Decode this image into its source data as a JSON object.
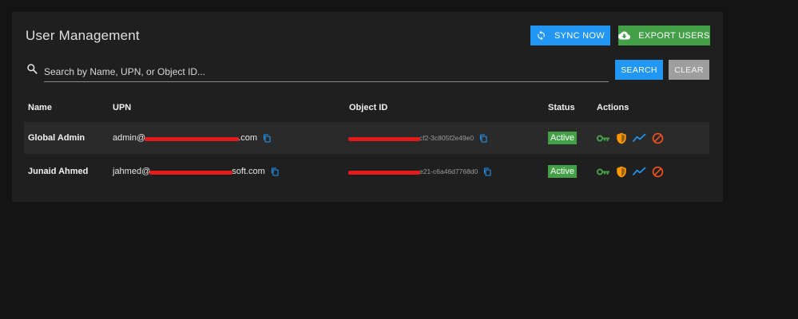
{
  "header": {
    "title": "User Management",
    "sync_label": "SYNC NOW",
    "export_label": "EXPORT USERS"
  },
  "search": {
    "placeholder": "Search by Name, UPN, or Object ID...",
    "value": "",
    "search_label": "SEARCH",
    "clear_label": "CLEAR"
  },
  "table": {
    "columns": [
      "Name",
      "UPN",
      "Object ID",
      "Status",
      "Actions"
    ],
    "rows": [
      {
        "name": "Global Admin",
        "upn_prefix": "admin@",
        "upn_suffix": ".com",
        "oid_suffix": "cf2-3c805f2e49e0",
        "status": "Active"
      },
      {
        "name": "Junaid Ahmed",
        "upn_prefix": "jahmed@",
        "upn_suffix": "soft.com",
        "oid_suffix": "e21-c6a46d7768d0",
        "status": "Active"
      }
    ],
    "action_icons": [
      "key-icon",
      "shield-icon",
      "activity-icon",
      "block-icon"
    ]
  },
  "colors": {
    "primary": "#2196f3",
    "success": "#43a047",
    "warning": "#ff9800",
    "danger": "#f4511e",
    "redaction": "#e31b1b"
  }
}
